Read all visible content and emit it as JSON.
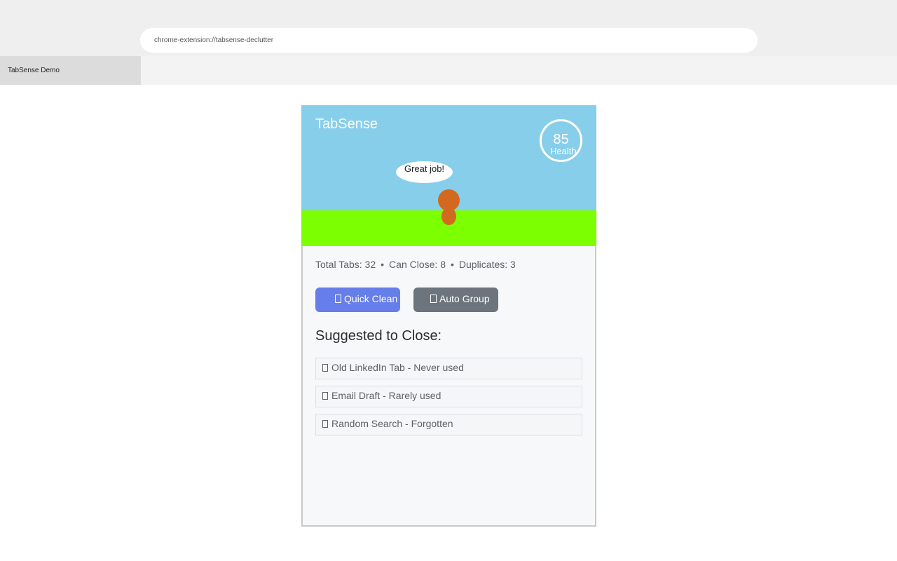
{
  "browser": {
    "url": "chrome-extension://tabsense-declutter",
    "tab_title": "TabSense Demo"
  },
  "popup": {
    "title": "TabSense",
    "health": {
      "value": "85",
      "label": "Health"
    },
    "mascot": {
      "speech": "Great job!"
    },
    "stats": {
      "total_tabs": "Total Tabs: 32",
      "can_close": "Can Close: 8",
      "duplicates": "Duplicates: 3",
      "separator": "•"
    },
    "actions": {
      "quick_clean": "Quick Clean",
      "auto_group": "Auto Group"
    },
    "suggestions": {
      "heading": "Suggested to Close:",
      "items": [
        {
          "label": "Old LinkedIn Tab - Never used"
        },
        {
          "label": "Email Draft - Rarely used"
        },
        {
          "label": "Random Search - Forgotten"
        }
      ]
    }
  },
  "colors": {
    "sky": "#87ceeb",
    "grass": "#7cff00",
    "mascot": "#d2691e",
    "quick_clean_button": "#667eea",
    "auto_group_button": "#6c757d"
  }
}
